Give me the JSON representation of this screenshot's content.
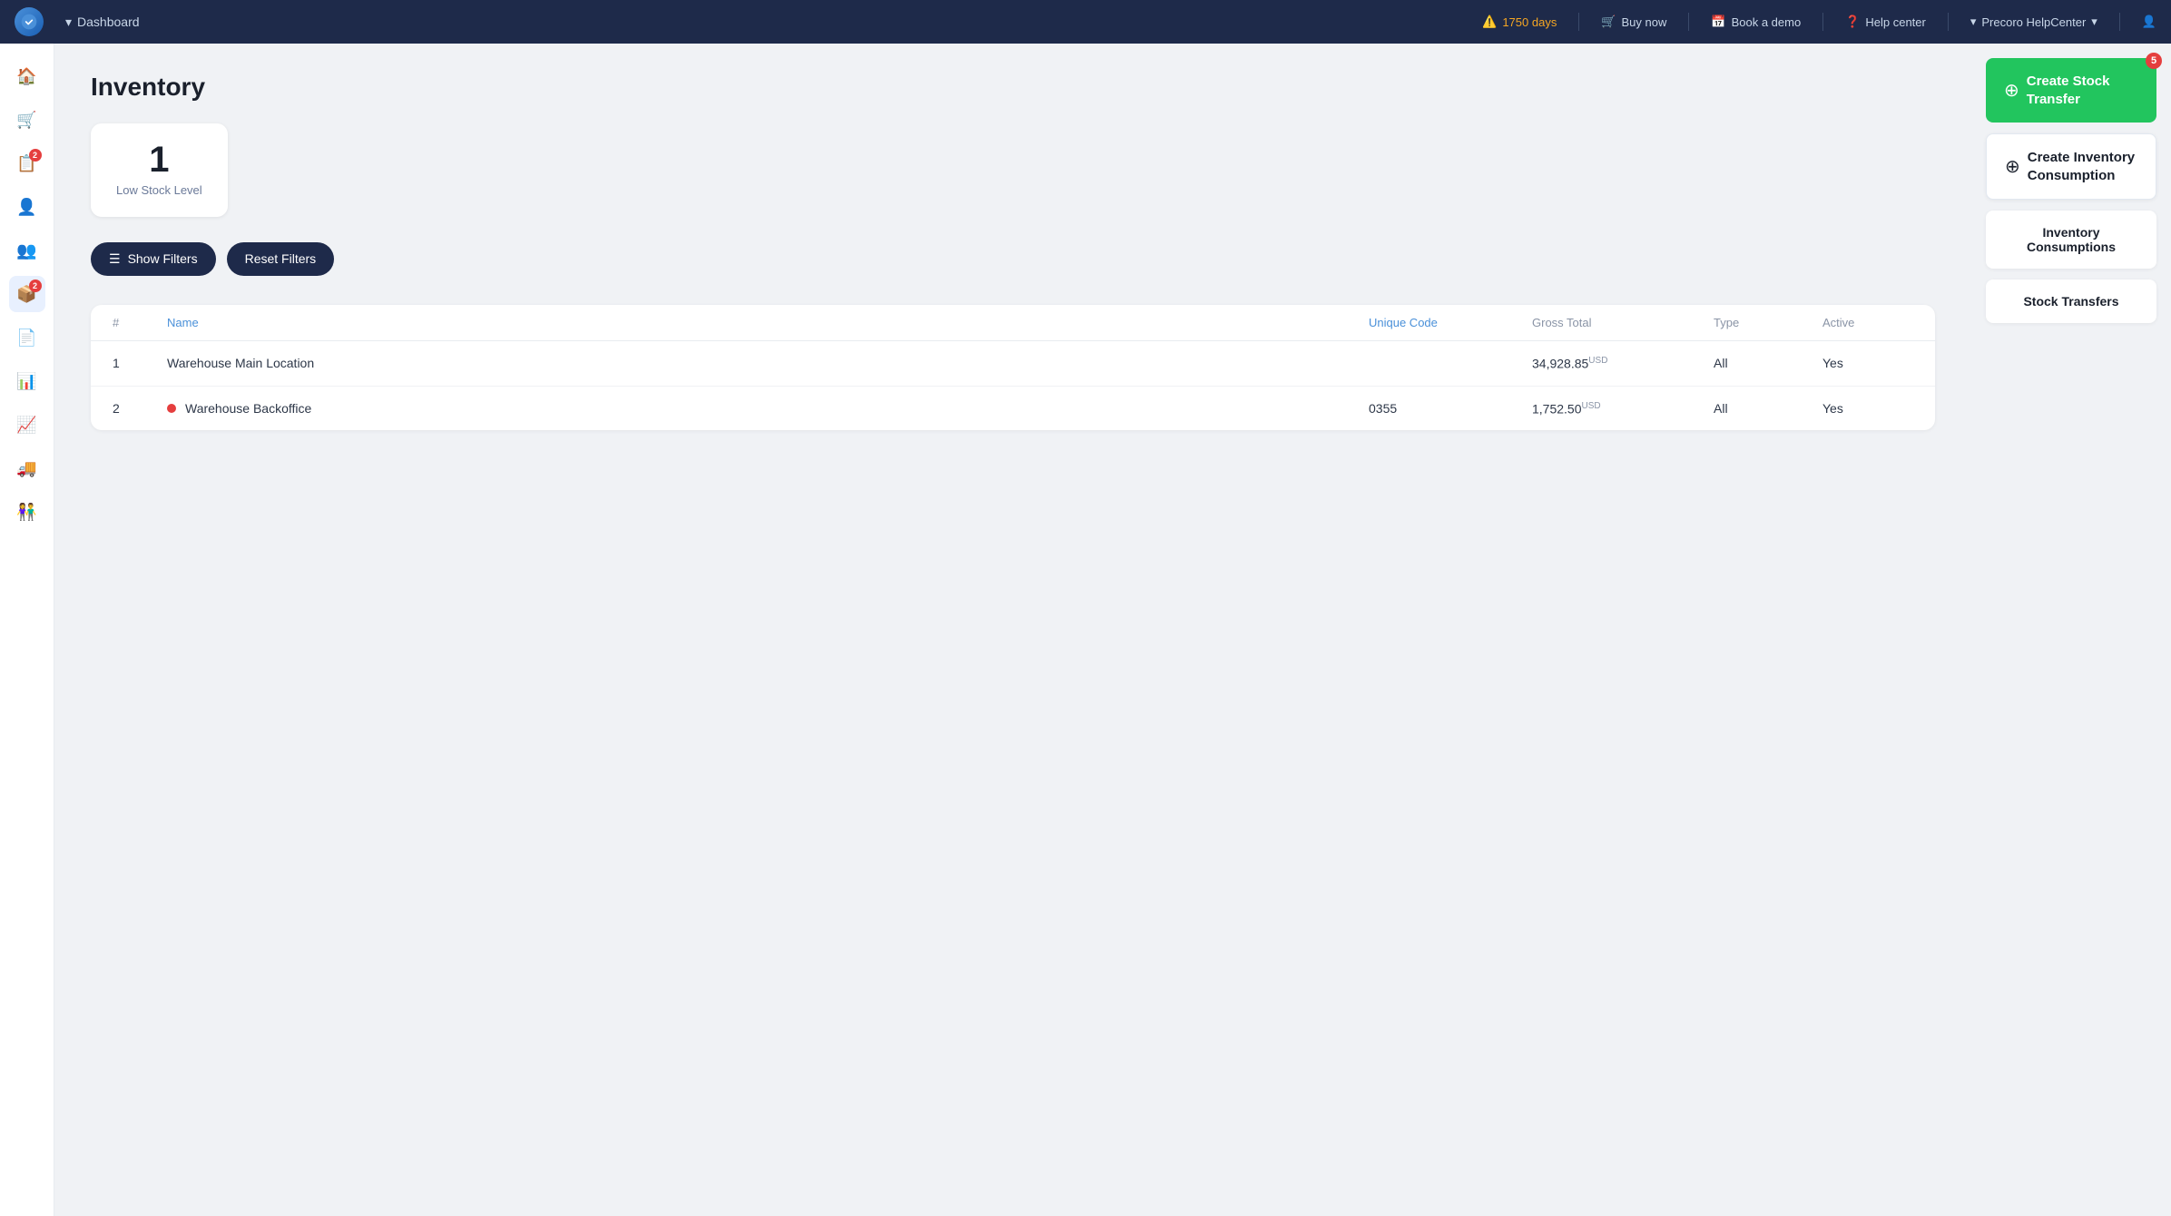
{
  "topnav": {
    "logo_alt": "Precoro",
    "dashboard_label": "Dashboard",
    "warning_days": "1750 days",
    "buy_now": "Buy now",
    "book_demo": "Book a demo",
    "help_center": "Help center",
    "org_name": "Precoro HelpCenter"
  },
  "sidebar": {
    "items": [
      {
        "id": "home",
        "icon": "🏠",
        "badge": null
      },
      {
        "id": "orders",
        "icon": "🛒",
        "badge": null
      },
      {
        "id": "receipts",
        "icon": "📋",
        "badge": "2"
      },
      {
        "id": "users",
        "icon": "👤",
        "badge": null
      },
      {
        "id": "people",
        "icon": "👥",
        "badge": null
      },
      {
        "id": "inventory",
        "icon": "📦",
        "badge": "2",
        "active": true
      },
      {
        "id": "reports",
        "icon": "📄",
        "badge": null
      },
      {
        "id": "analytics",
        "icon": "📊",
        "badge": null
      },
      {
        "id": "chart",
        "icon": "📈",
        "badge": null
      },
      {
        "id": "delivery",
        "icon": "🚚",
        "badge": null
      },
      {
        "id": "team",
        "icon": "👫",
        "badge": null
      }
    ]
  },
  "page": {
    "title": "Inventory"
  },
  "stats": {
    "low_stock": {
      "number": "1",
      "label": "Low Stock Level"
    }
  },
  "filters": {
    "show_label": "Show Filters",
    "reset_label": "Reset Filters"
  },
  "table": {
    "columns": [
      "#",
      "Name",
      "Unique Code",
      "Gross Total",
      "Type",
      "Active"
    ],
    "rows": [
      {
        "num": "1",
        "name": "Warehouse Main Location",
        "unique_code": "",
        "gross_total": "34,928.85",
        "gross_total_currency": "USD",
        "type": "All",
        "active": "Yes",
        "has_dot": false
      },
      {
        "num": "2",
        "name": "Warehouse Backoffice",
        "unique_code": "0355",
        "gross_total": "1,752.50",
        "gross_total_currency": "USD",
        "type": "All",
        "active": "Yes",
        "has_dot": true
      }
    ]
  },
  "right_panel": {
    "create_transfer": {
      "label": "Create Stock Transfer",
      "badge": "5"
    },
    "create_inventory": {
      "label": "Create Inventory Consumption"
    },
    "inventory_consumptions": "Inventory Consumptions",
    "stock_transfers": "Stock Transfers"
  }
}
